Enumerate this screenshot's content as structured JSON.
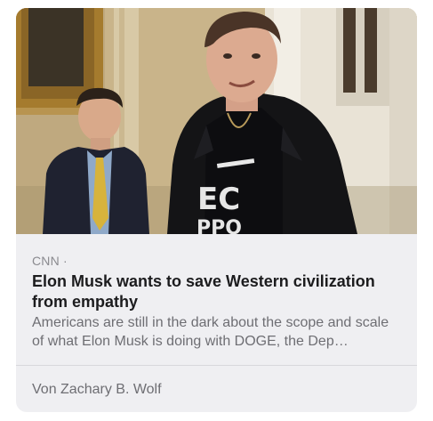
{
  "card": {
    "image_alt": "Elon Musk in a corridor with a man in a suit in the background",
    "source": "CNN ·",
    "headline": "Elon Musk wants to save Western civilization from empathy",
    "summary": "Americans are still in the dark about the scope and scale of what Elon Musk is doing with DOGE, the Dep…",
    "author": "Von Zachary B. Wolf"
  },
  "colors": {
    "card_background": "#efeff2",
    "headline": "#1c1c1e",
    "secondary_text": "#6e6e73"
  }
}
